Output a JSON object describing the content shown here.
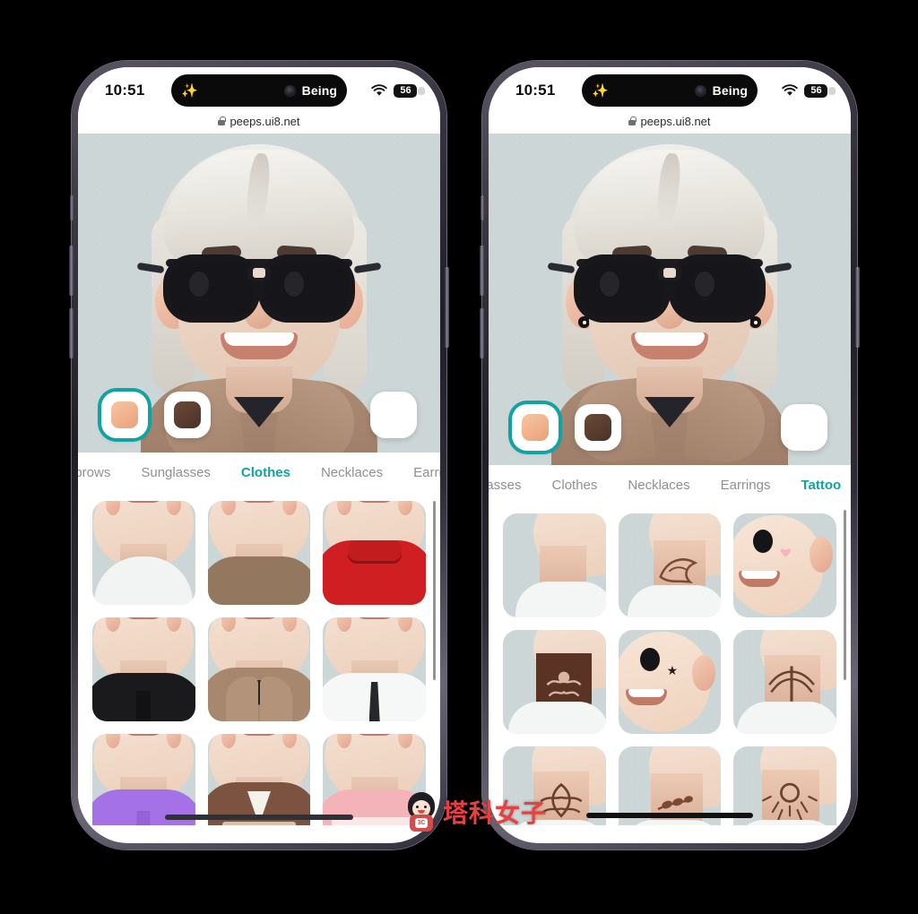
{
  "background_color": "#000000",
  "accent_color": "#0fa3a3",
  "phones": [
    {
      "id": "left",
      "status_bar": {
        "time": "10:51",
        "dynamic_island": {
          "sparkle_icon": "✨",
          "app_label": "Being",
          "camera_icon": "camera-dot"
        },
        "wifi_icon": "wifi-icon",
        "battery_level": "56"
      },
      "browser": {
        "lock_icon": "lock-icon",
        "url": "peeps.ui8.net"
      },
      "avatar": {
        "hair_color": "#e6e3dc",
        "skin_color": "#edd7c6",
        "glasses": "black-aviator-sunglasses",
        "clothing": "brown-hoodie",
        "background_color": "#ccd6d6"
      },
      "swatches": [
        {
          "name": "skin-peach",
          "color": "#f0b78f",
          "selected": true
        },
        {
          "name": "dark-brown",
          "color": "#5b3f31",
          "selected": false
        },
        {
          "name": "empty",
          "color": "#ffffff",
          "selected": false
        }
      ],
      "tabs": [
        {
          "label": "ebrows",
          "active": false,
          "clipped": true
        },
        {
          "label": "Sunglasses",
          "active": false
        },
        {
          "label": "Clothes",
          "active": true
        },
        {
          "label": "Necklaces",
          "active": false
        },
        {
          "label": "Earri",
          "active": false,
          "clipped": true
        }
      ],
      "grid": {
        "title": "Clothes",
        "items": [
          {
            "name": "white-tank-top",
            "color": "#f2f4f4",
            "selected": false,
            "style": "tank"
          },
          {
            "name": "brown-tshirt",
            "color": "#93775f",
            "selected": false,
            "style": "tee"
          },
          {
            "name": "red-turtleneck",
            "color": "#cf1f22",
            "selected": true,
            "style": "turtleneck"
          },
          {
            "name": "black-polo",
            "color": "#1a1a1d",
            "selected": false,
            "style": "polo"
          },
          {
            "name": "brown-hoodie",
            "color": "#a8876f",
            "selected": true,
            "style": "hoodie"
          },
          {
            "name": "white-shirt-tie",
            "color": "#f6f7f7",
            "selected": false,
            "style": "shirt-tie"
          },
          {
            "name": "purple-polo",
            "color": "#a471e6",
            "selected": false,
            "style": "polo"
          },
          {
            "name": "brown-jacket",
            "color": "#7c5240",
            "selected": false,
            "style": "jacket"
          },
          {
            "name": "pink-top",
            "color": "#f4b3b8",
            "selected": false,
            "style": "tee"
          }
        ]
      }
    },
    {
      "id": "right",
      "status_bar": {
        "time": "10:51",
        "dynamic_island": {
          "sparkle_icon": "✨",
          "app_label": "Being",
          "camera_icon": "camera-dot"
        },
        "wifi_icon": "wifi-icon",
        "battery_level": "56"
      },
      "browser": {
        "lock_icon": "lock-icon",
        "url": "peeps.ui8.net"
      },
      "avatar": {
        "hair_color": "#e6e3dc",
        "skin_color": "#edd7c6",
        "glasses": "black-aviator-sunglasses",
        "clothing": "brown-hoodie",
        "earrings": "black-stud-earrings",
        "background_color": "#ccd6d6"
      },
      "swatches": [
        {
          "name": "skin-peach",
          "color": "#f0b78f",
          "selected": true
        },
        {
          "name": "dark-brown",
          "color": "#5b3f31",
          "selected": false
        },
        {
          "name": "empty",
          "color": "#ffffff",
          "selected": false
        }
      ],
      "tabs": [
        {
          "label": "lasses",
          "active": false,
          "clipped": true
        },
        {
          "label": "Clothes",
          "active": false
        },
        {
          "label": "Necklaces",
          "active": false
        },
        {
          "label": "Earrings",
          "active": false
        },
        {
          "label": "Tattoo",
          "active": true
        }
      ],
      "grid": {
        "title": "Tattoo",
        "items": [
          {
            "name": "no-tattoo",
            "color": "#ffffff",
            "selected": false,
            "style": "neck-plain"
          },
          {
            "name": "neck-swirl-tattoo",
            "color": "#7a4a33",
            "selected": false,
            "style": "neck-ink"
          },
          {
            "name": "face-heart-tattoo",
            "color": "#e8a0a8",
            "selected": true,
            "style": "face-mark"
          },
          {
            "name": "neck-floral-dark",
            "color": "#5a3325",
            "selected": false,
            "style": "neck-ink"
          },
          {
            "name": "face-star-tattoo",
            "color": "#2a2a2f",
            "selected": false,
            "style": "face-mark"
          },
          {
            "name": "neck-wing-tattoo",
            "color": "#6b4130",
            "selected": false,
            "style": "neck-ink"
          },
          {
            "name": "neck-damask-tattoo",
            "color": "#6d3f2c",
            "selected": false,
            "style": "neck-ink"
          },
          {
            "name": "neck-leaf-tattoo",
            "color": "#7a4a33",
            "selected": false,
            "style": "neck-ink"
          },
          {
            "name": "neck-mandala-tattoo",
            "color": "#6b4130",
            "selected": false,
            "style": "neck-ink"
          }
        ]
      }
    }
  ],
  "watermark": {
    "text": "塔科女子",
    "badge": "3C",
    "color": "#e8403f"
  }
}
